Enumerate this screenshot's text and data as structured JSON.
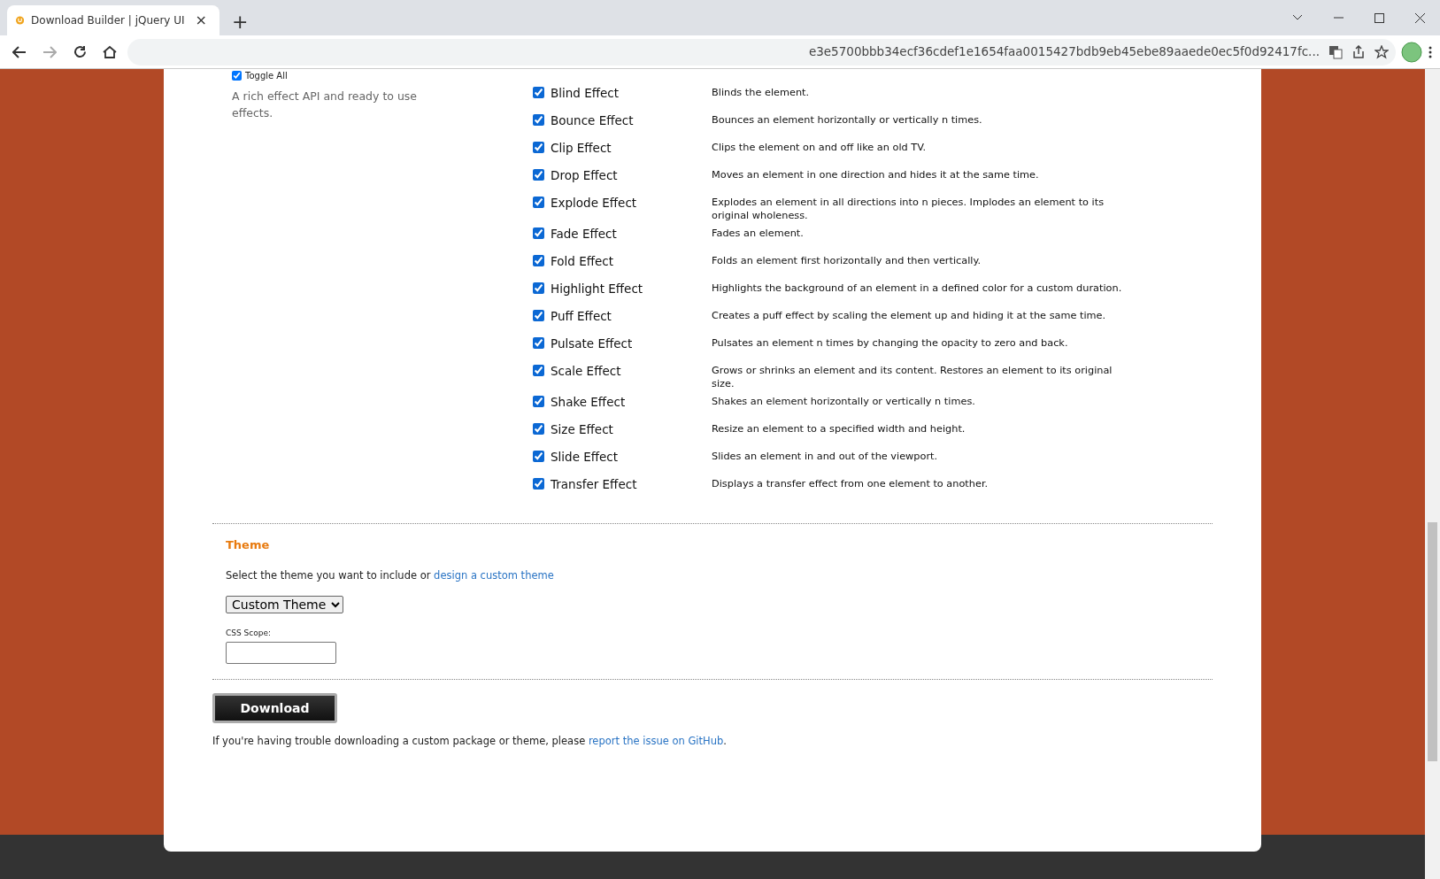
{
  "browser": {
    "tab_title": "Download Builder | jQuery UI",
    "tab_close": "×",
    "new_tab": "+",
    "url": "e3e5700bbb34ecf36cdef1e1654faa0015427bdb9eb45ebe89aaede0ec5f0d92417fc..."
  },
  "effects": {
    "toggle_all": {
      "label": "Toggle All",
      "checked": true
    },
    "description": "A rich effect API and ready to use effects.",
    "items": [
      {
        "name": "Blind Effect",
        "description": "Blinds the element.",
        "checked": true
      },
      {
        "name": "Bounce Effect",
        "description": "Bounces an element horizontally or vertically n times.",
        "checked": true
      },
      {
        "name": "Clip Effect",
        "description": "Clips the element on and off like an old TV.",
        "checked": true
      },
      {
        "name": "Drop Effect",
        "description": "Moves an element in one direction and hides it at the same time.",
        "checked": true
      },
      {
        "name": "Explode Effect",
        "description": "Explodes an element in all directions into n pieces. Implodes an element to its original wholeness.",
        "checked": true
      },
      {
        "name": "Fade Effect",
        "description": "Fades an element.",
        "checked": true
      },
      {
        "name": "Fold Effect",
        "description": "Folds an element first horizontally and then vertically.",
        "checked": true
      },
      {
        "name": "Highlight Effect",
        "description": "Highlights the background of an element in a defined color for a custom duration.",
        "checked": true
      },
      {
        "name": "Puff Effect",
        "description": "Creates a puff effect by scaling the element up and hiding it at the same time.",
        "checked": true
      },
      {
        "name": "Pulsate Effect",
        "description": "Pulsates an element n times by changing the opacity to zero and back.",
        "checked": true
      },
      {
        "name": "Scale Effect",
        "description": "Grows or shrinks an element and its content. Restores an element to its original size.",
        "checked": true
      },
      {
        "name": "Shake Effect",
        "description": "Shakes an element horizontally or vertically n times.",
        "checked": true
      },
      {
        "name": "Size Effect",
        "description": "Resize an element to a specified width and height.",
        "checked": true
      },
      {
        "name": "Slide Effect",
        "description": "Slides an element in and out of the viewport.",
        "checked": true
      },
      {
        "name": "Transfer Effect",
        "description": "Displays a transfer effect from one element to another.",
        "checked": true
      }
    ]
  },
  "theme": {
    "title": "Theme",
    "prompt": "Select the theme you want to include or ",
    "link": "design a custom theme",
    "select_value": "Custom Theme",
    "scope_label": "CSS Scope:"
  },
  "download_button": "Download",
  "footer": {
    "text": "If you're having trouble downloading a custom package or theme, please ",
    "link": "report the issue on GitHub",
    "end": "."
  }
}
